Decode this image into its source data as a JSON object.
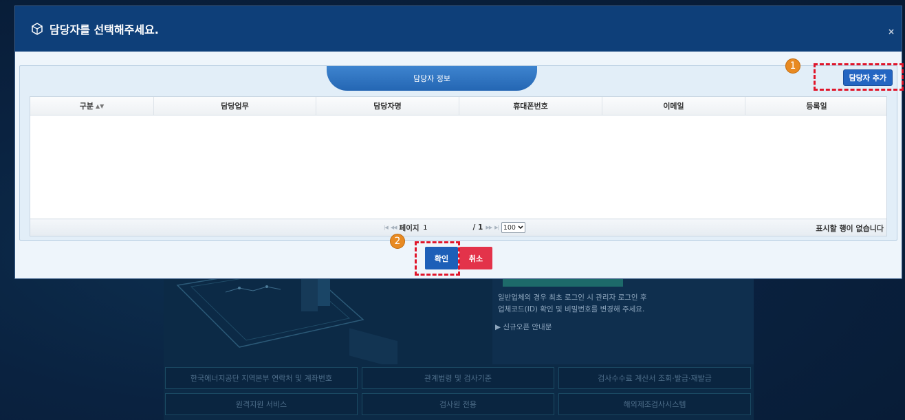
{
  "background": {
    "info_lines": [
      "일반업체의 경우 최초 로그인 시 관리자 로그인 후",
      "업체코드(ID) 확인 및 비밀번호를 변경해 주세요."
    ],
    "notice": "▶ 신규오픈 안내문",
    "links": [
      "한국에너지공단 지역본부 연락처 및 계좌번호",
      "관계법령 및 검사기준",
      "검사수수료 계산서 조회·발급·재발급",
      "원격지원 서비스",
      "검사원 전용",
      "해외제조검사시스템"
    ]
  },
  "modal": {
    "title": "담당자를 선택해주세요.",
    "close_label": "×",
    "tab_label": "담당자 정보",
    "add_button": "담당자 추가",
    "columns": [
      "구분",
      "담당업무",
      "담당자명",
      "휴대폰번호",
      "이메일",
      "등록일"
    ],
    "sort_icon": "▲▼",
    "pager": {
      "page_label": "페이지",
      "page_value": "1",
      "total": "/ 1",
      "rows_per_page": "100",
      "empty_message": "표시할 행이 없습니다"
    },
    "confirm_button": "확인",
    "cancel_button": "취소"
  },
  "annotations": {
    "marker_1": "1",
    "marker_2": "2"
  },
  "colors": {
    "header": "#0e3f79",
    "primary_button": "#1d5fb8",
    "cancel_button": "#e3334a",
    "annotation_circle": "#e88a22",
    "annotation_box": "#e0152a"
  }
}
